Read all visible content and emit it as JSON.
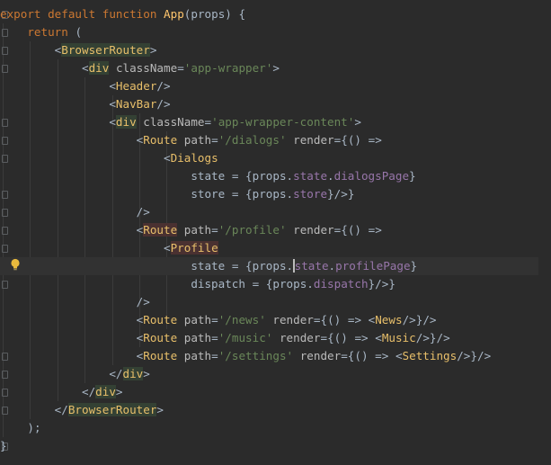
{
  "editor": {
    "language": "JavaScript (JSX)",
    "lines": [
      "export default function App(props) {",
      "    return (",
      "        <BrowserRouter>",
      "            <div className='app-wrapper'>",
      "                <Header/>",
      "                <NavBar/>",
      "                <div className='app-wrapper-content'>",
      "                    <Route path='/dialogs' render={() =>",
      "                        <Dialogs",
      "                            state = {props.state.dialogsPage}",
      "                            store = {props.store}/>}",
      "                    />",
      "                    <Route path='/profile' render={() =>",
      "                        <Profile",
      "                            state = {props.state.profilePage}",
      "                            dispatch = {props.dispatch}/>}",
      "                    />",
      "                    <Route path='/news' render={() => <News/>}/>",
      "                    <Route path='/music' render={() => <Music/>}/>",
      "                    <Route path='/settings' render={() => <Settings/>}/>",
      "                </div>",
      "            </div>",
      "        </BrowserRouter>",
      "    );",
      "}"
    ],
    "current_line": 15,
    "colors": {
      "background": "#2b2b2b",
      "keyword": "#cc7832",
      "function": "#ffc66d",
      "tag": "#e8bf6a",
      "attribute": "#bababa",
      "string": "#6a8759",
      "property": "#9876aa",
      "text": "#a9b7c6"
    },
    "icons": {
      "intention": "lightbulb-icon",
      "fold": "fold-marker-icon"
    }
  }
}
